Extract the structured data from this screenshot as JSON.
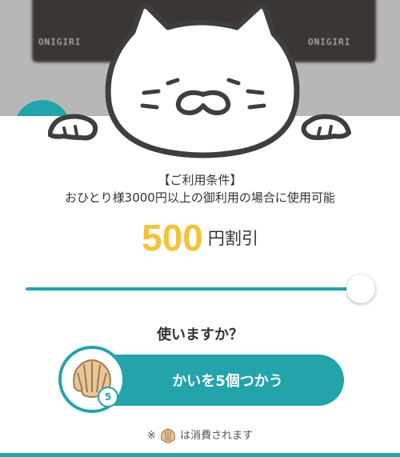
{
  "background": {
    "product_text_left": "ONIGIRI",
    "product_text_right": "ONIGIRI"
  },
  "coupon": {
    "condition_title": "【ご利用条件】",
    "condition_text": "おひとり様3000円以上の御利用の場合に使用可能",
    "discount_amount": "500",
    "discount_unit": "円割引",
    "slider_level": 1.0
  },
  "prompt": {
    "question": "使いますか？"
  },
  "action": {
    "use_button_label": "かいを5個つかう",
    "shell_count": "5"
  },
  "note": {
    "prefix": "※",
    "text": "は消費されます"
  },
  "colors": {
    "accent": "#23a4ab",
    "discount": "#f6c13b"
  },
  "icons": {
    "mascot": "cat-mascot-icon",
    "shell": "shell-icon"
  }
}
